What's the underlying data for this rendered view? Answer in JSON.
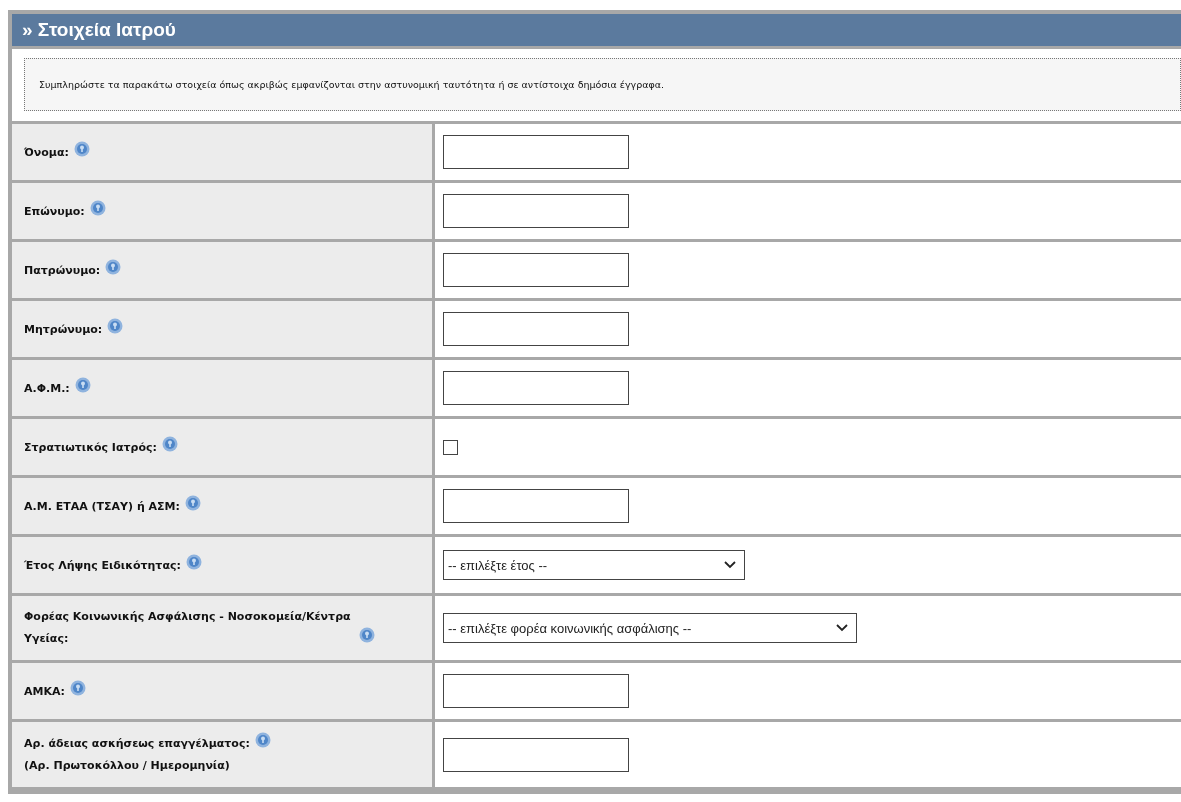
{
  "section": {
    "title": "» Στοιχεία Ιατρού"
  },
  "note": "Συμπληρώστε τα παρακάτω στοιχεία όπως ακριβώς εμφανίζονται στην αστυνομική ταυτότητα ή σε αντίστοιχα δημόσια έγγραφα.",
  "fields": [
    {
      "label": "Όνομα:",
      "kind": "text"
    },
    {
      "label": "Επώνυμο:",
      "kind": "text"
    },
    {
      "label": "Πατρώνυμο:",
      "kind": "text"
    },
    {
      "label": "Μητρώνυμο:",
      "kind": "text"
    },
    {
      "label": "Α.Φ.Μ.:",
      "kind": "text"
    },
    {
      "label": "Στρατιωτικός Ιατρός:",
      "kind": "checkbox",
      "checked": false
    },
    {
      "label": "Α.Μ. ΕΤΑΑ (ΤΣΑΥ) ή ΑΣΜ:",
      "kind": "text"
    },
    {
      "label": "Έτος Λήψης Ειδικότητας:",
      "kind": "select",
      "value": "-- επιλέξτε έτος --"
    },
    {
      "label": "Φορέας Κοινωνικής Ασφάλισης - Νοσοκομεία/Κέντρα Υγείας:",
      "kind": "select",
      "value": "-- επιλέξτε φορέα κοινωνικής ασφάλισης --",
      "wide": true
    },
    {
      "label": "ΑΜΚΑ:",
      "kind": "text"
    },
    {
      "label": "Αρ. άδειας ασκήσεως επαγγέλματος:",
      "sublabel": "(Αρ. Πρωτοκόλλου / Ημερομηνία)",
      "kind": "text"
    }
  ]
}
